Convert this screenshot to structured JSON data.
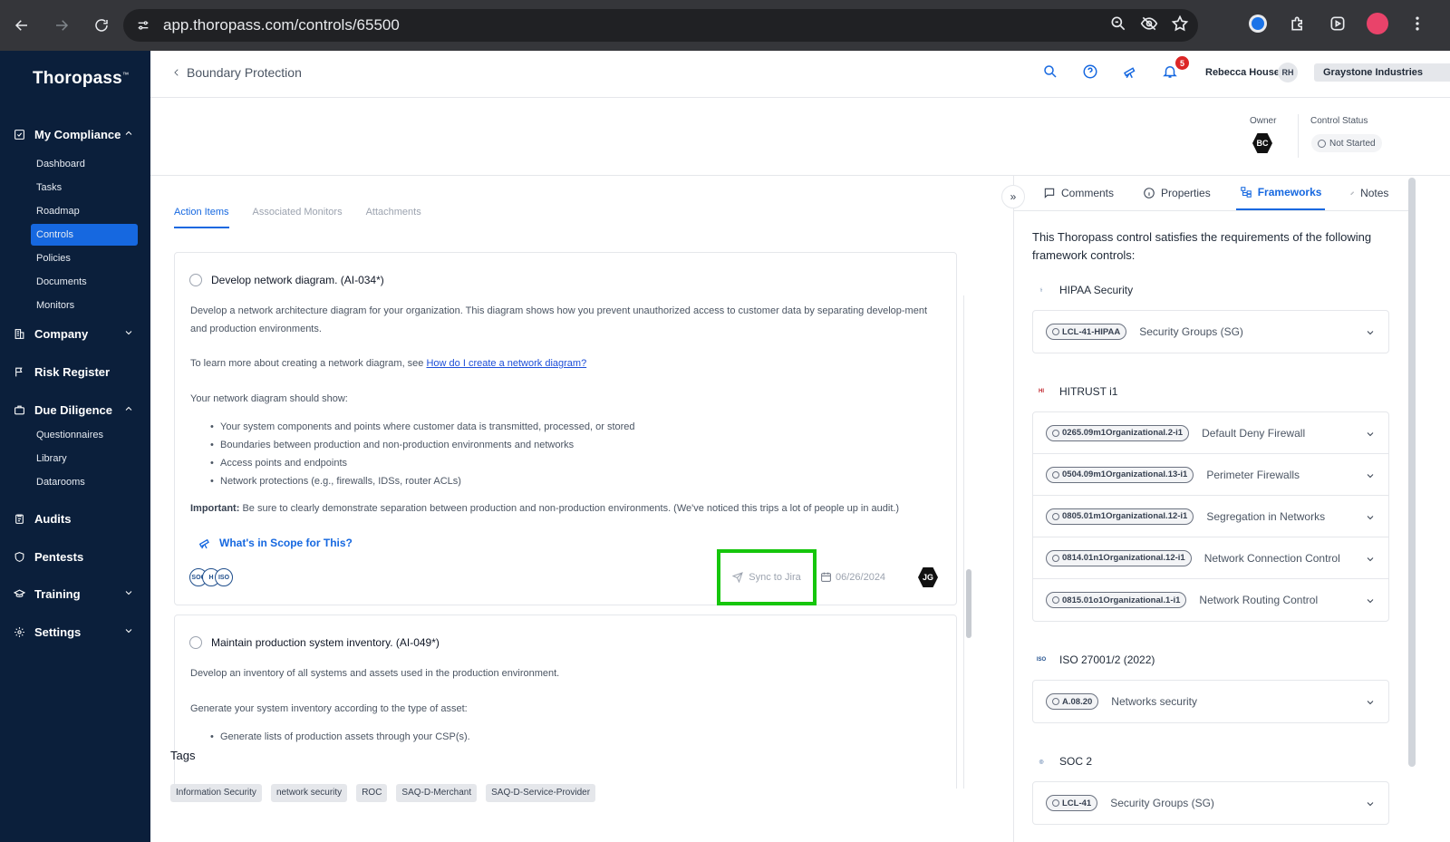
{
  "browser": {
    "url": "app.thoropass.com/controls/65500"
  },
  "sidebar": {
    "brand": "Thoropass",
    "brand_mark": "™",
    "groups": [
      {
        "label": "My Compliance",
        "items": [
          "Dashboard",
          "Tasks",
          "Roadmap",
          "Controls",
          "Policies",
          "Documents",
          "Monitors"
        ],
        "active": "Controls"
      },
      {
        "label": "Company"
      },
      {
        "label": "Risk Register"
      },
      {
        "label": "Due Diligence",
        "items": [
          "Questionnaires",
          "Library",
          "Datarooms"
        ]
      },
      {
        "label": "Audits"
      },
      {
        "label": "Pentests"
      },
      {
        "label": "Training"
      },
      {
        "label": "Settings"
      }
    ]
  },
  "header": {
    "back_label": "Boundary Protection",
    "notifications_count": "5",
    "user_name": "Rebecca Houser",
    "user_initials": "RH",
    "org_name": "Graystone Industries"
  },
  "meta": {
    "owner_label": "Owner",
    "owner_initials": "BC",
    "status_label": "Control Status",
    "status_value": "Not Started"
  },
  "tabs": [
    "Action Items",
    "Associated Monitors",
    "Attachments"
  ],
  "action_items": [
    {
      "title": "Develop network diagram. (AI-034*)",
      "description": "Develop a network architecture diagram for your organization. This diagram shows how you prevent unauthorized access to customer data by separating develop-ment and production environments.",
      "learn_prefix": "To learn more about creating a network diagram, see ",
      "learn_link": "How do I create a network diagram?",
      "should_show": "Your network diagram should show:",
      "bullets": [
        "Your system components and points where customer data is transmitted, processed, or stored",
        "Boundaries between production and non-production environments and networks",
        "Access points and endpoints",
        "Network protections (e.g., firewalls, IDSs, router ACLs)"
      ],
      "important_label": "Important:",
      "important_text": " Be sure to clearly demonstrate separation between production and non-production environments. (We've noticed this trips a lot of people up in audit.)",
      "scope_link": "What's in Scope for This?",
      "sync_label": "Sync to Jira",
      "due_date": "06/26/2024",
      "assignee_initials": "JG"
    },
    {
      "title": "Maintain production system inventory. (AI-049*)",
      "description": "Develop an inventory of all systems and assets used in the production environment.",
      "generate": "Generate your system inventory according to the type of asset:",
      "bullets": [
        "Generate lists of production assets through your CSP(s)."
      ]
    }
  ],
  "tags": {
    "title": "Tags",
    "items": [
      "Information Security",
      "network security",
      "ROC",
      "SAQ-D-Merchant",
      "SAQ-D-Service-Provider"
    ]
  },
  "right_panel": {
    "tabs": [
      "Comments",
      "Properties",
      "Frameworks",
      "Notes"
    ],
    "active_tab": "Frameworks",
    "intro": "This Thoropass control satisfies the requirements of the following framework controls:",
    "frameworks": [
      {
        "name": "HIPAA Security",
        "controls": [
          {
            "id": "LCL-41-HIPAA",
            "name": "Security Groups (SG)"
          }
        ]
      },
      {
        "name": "HITRUST i1",
        "controls": [
          {
            "id": "0265.09m1Organizational.2-i1",
            "name": "Default Deny Firewall"
          },
          {
            "id": "0504.09m1Organizational.13-i1",
            "name": "Perimeter Firewalls"
          },
          {
            "id": "0805.01m1Organizational.12-i1",
            "name": "Segregation in Networks"
          },
          {
            "id": "0814.01n1Organizational.12-i1",
            "name": "Network Connection Control"
          },
          {
            "id": "0815.01o1Organizational.1-i1",
            "name": "Network Routing Control"
          }
        ]
      },
      {
        "name": "ISO 27001/2 (2022)",
        "controls": [
          {
            "id": "A.08.20",
            "name": "Networks security"
          }
        ]
      },
      {
        "name": "SOC 2",
        "controls": [
          {
            "id": "LCL-41",
            "name": "Security Groups (SG)"
          }
        ]
      }
    ]
  },
  "colors": {
    "sidebar_bg": "#0b1f3b",
    "accent": "#1668e0",
    "highlight_box": "#16c60c"
  }
}
